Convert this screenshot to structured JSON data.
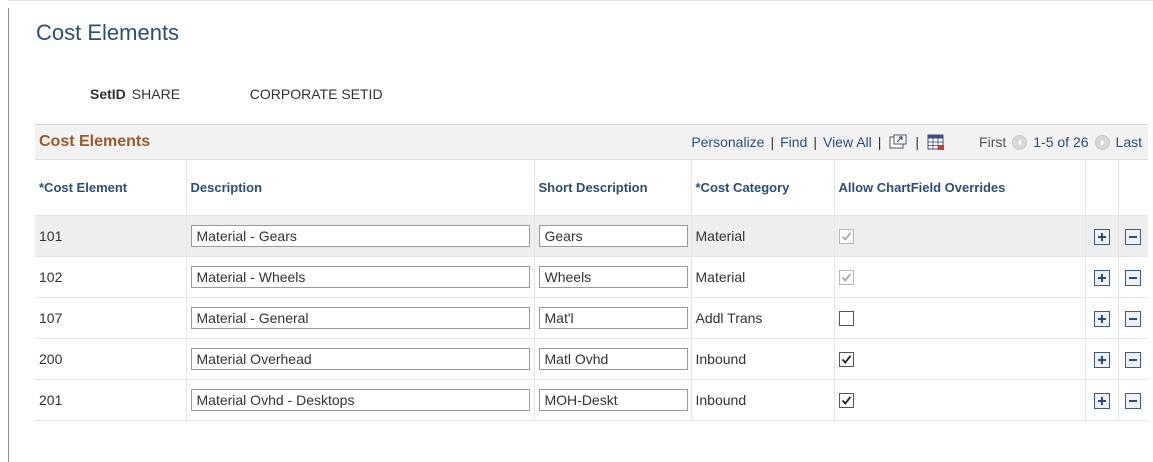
{
  "page": {
    "title": "Cost Elements"
  },
  "setid": {
    "label": "SetID",
    "value": "SHARE",
    "description": "CORPORATE SETID"
  },
  "grid": {
    "title": "Cost Elements",
    "nav": {
      "personalize": "Personalize",
      "separator": "|",
      "find": "Find",
      "view_all": "View All",
      "first": "First",
      "range": "1-5 of 26",
      "last": "Last",
      "zoom_icon": "zoom-icon",
      "download_icon": "spreadsheet-icon"
    },
    "columns": {
      "cost_element": "*Cost Element",
      "description": "Description",
      "short_description": "Short Description",
      "cost_category": "*Cost Category",
      "allow_overrides": "Allow ChartField Overrides"
    },
    "rows": [
      {
        "cost_element": "101",
        "description": "Material - Gears",
        "short_description": "Gears",
        "cost_category": "Material",
        "allow_overrides": true,
        "override_enabled": false
      },
      {
        "cost_element": "102",
        "description": "Material - Wheels",
        "short_description": "Wheels",
        "cost_category": "Material",
        "allow_overrides": true,
        "override_enabled": false
      },
      {
        "cost_element": "107",
        "description": "Material - General",
        "short_description": "Mat'l",
        "cost_category": "Addl Trans",
        "allow_overrides": false,
        "override_enabled": true
      },
      {
        "cost_element": "200",
        "description": "Material Overhead",
        "short_description": "Matl Ovhd",
        "cost_category": "Inbound",
        "allow_overrides": true,
        "override_enabled": true
      },
      {
        "cost_element": "201",
        "description": "Material Ovhd - Desktops",
        "short_description": "MOH-Deskt",
        "cost_category": "Inbound",
        "allow_overrides": true,
        "override_enabled": true
      }
    ],
    "row_buttons": {
      "add_icon": "plus-icon",
      "delete_icon": "minus-icon"
    }
  },
  "colors": {
    "title_blue": "#2a4e7c",
    "grid_title_brown": "#9a5a2a",
    "header_bg": "#f2f2f2"
  }
}
